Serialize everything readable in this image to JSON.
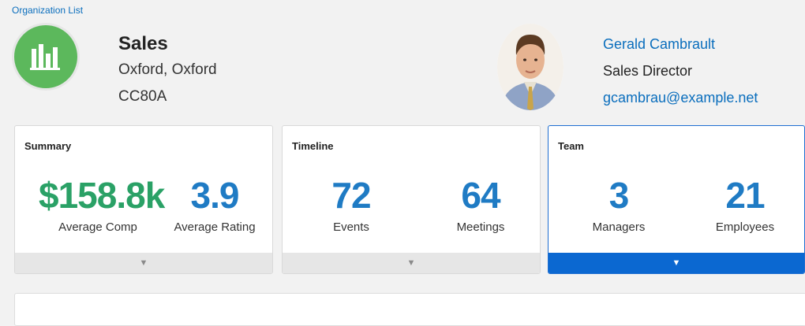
{
  "breadcrumb": {
    "label": "Organization List"
  },
  "organization": {
    "icon": "bar-chart-icon",
    "name": "Sales",
    "location": "Oxford, Oxford",
    "code": "CC80A",
    "logo_color": "#5cb85c"
  },
  "manager": {
    "avatar": "person-photo",
    "name": "Gerald Cambrault",
    "title": "Sales Director",
    "email": "gcambrau@example.net"
  },
  "cards": [
    {
      "title": "Summary",
      "metrics": [
        {
          "value": "$158.8k",
          "label": "Average Comp",
          "color": "#2aa166"
        },
        {
          "value": "3.9",
          "label": "Average Rating",
          "color": "#1f7bc4"
        }
      ],
      "footer_icon": "triangle-down-icon",
      "active": false
    },
    {
      "title": "Timeline",
      "metrics": [
        {
          "value": "72",
          "label": "Events",
          "color": "#1f7bc4"
        },
        {
          "value": "64",
          "label": "Meetings",
          "color": "#1f7bc4"
        }
      ],
      "footer_icon": "triangle-down-icon",
      "active": false
    },
    {
      "title": "Team",
      "metrics": [
        {
          "value": "3",
          "label": "Managers",
          "color": "#1f7bc4"
        },
        {
          "value": "21",
          "label": "Employees",
          "color": "#1f7bc4"
        }
      ],
      "footer_icon": "triangle-down-icon",
      "active": true
    }
  ],
  "colors": {
    "accent": "#0b68d1",
    "link": "#0a6ebd"
  }
}
